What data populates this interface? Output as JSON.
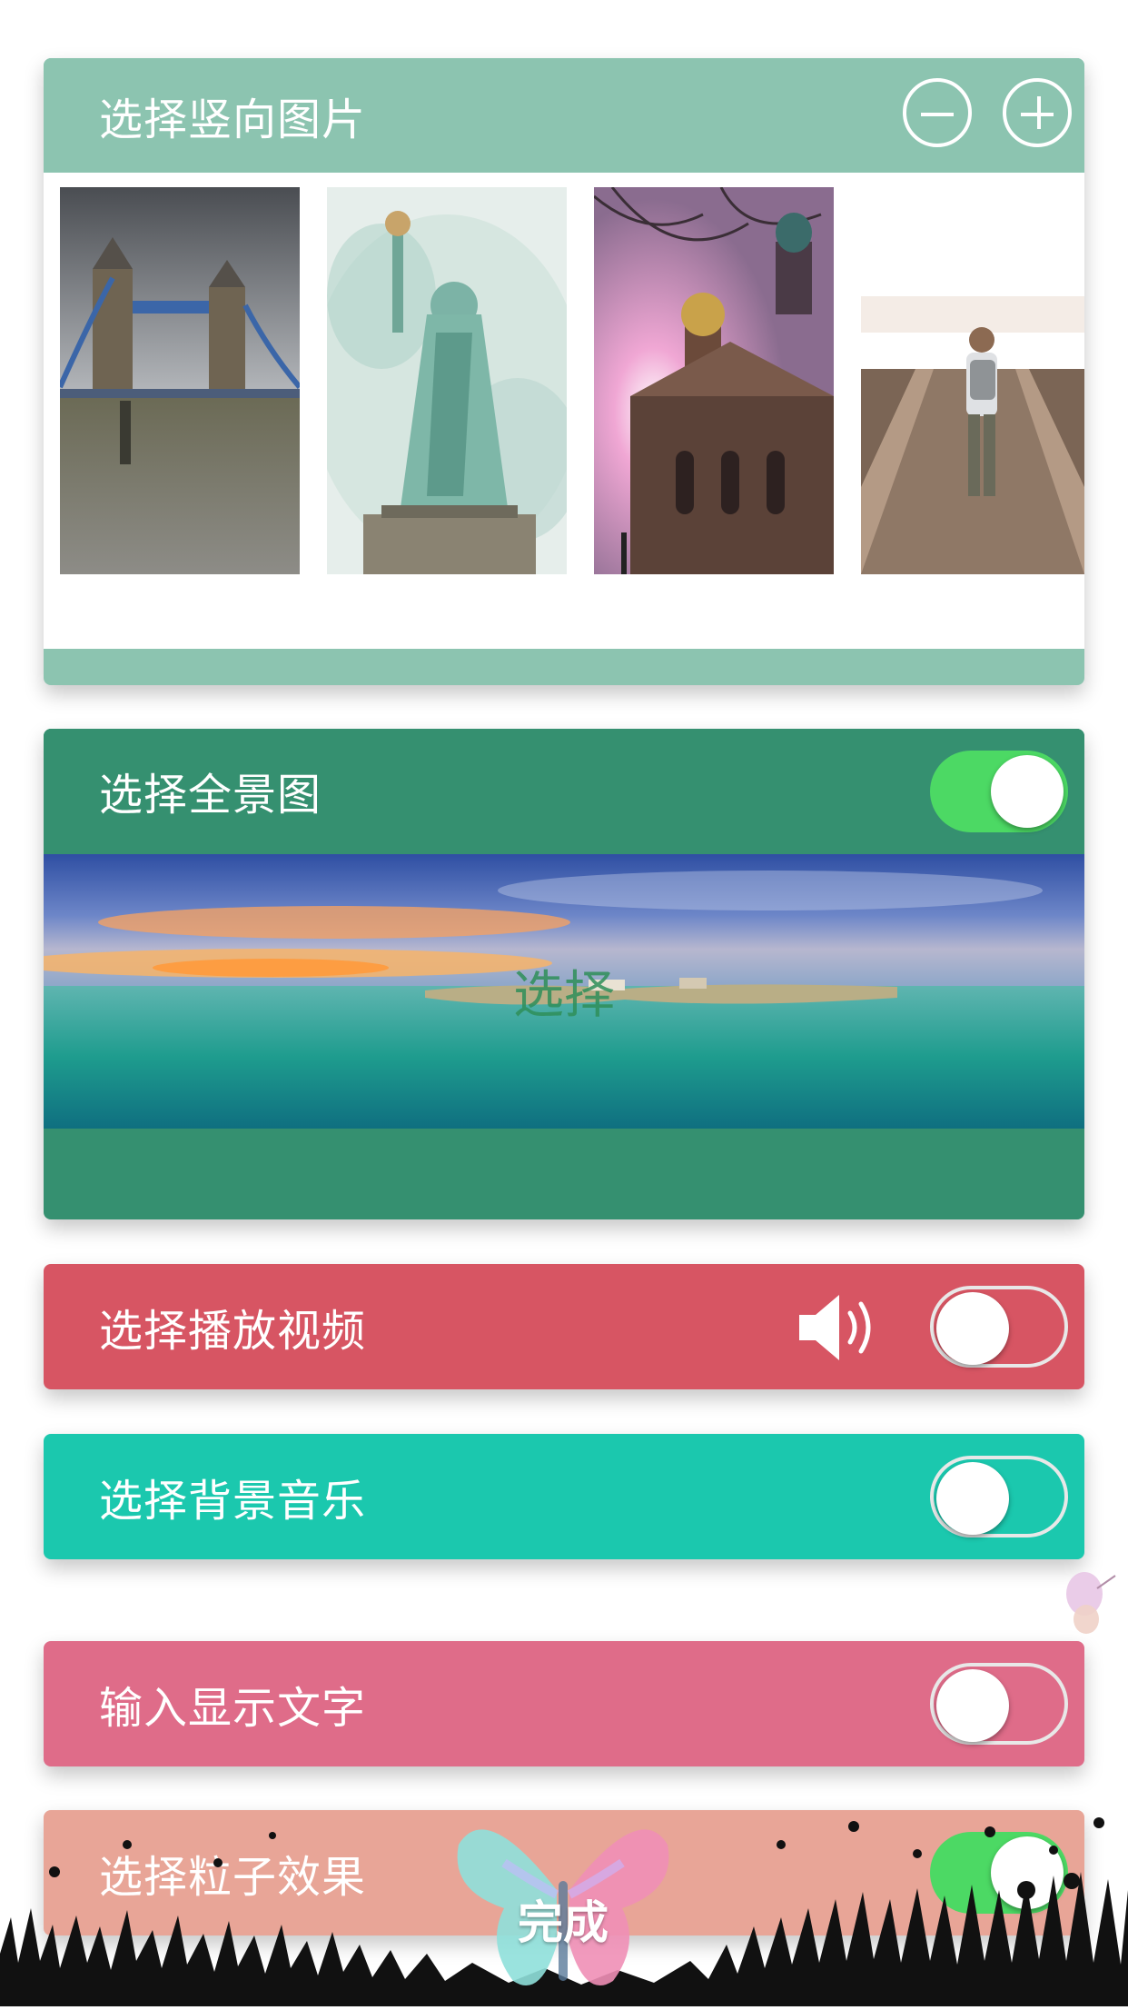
{
  "sections": {
    "vertical_images": {
      "title": "选择竖向图片"
    },
    "panorama": {
      "title": "选择全景图",
      "overlay_label": "选择",
      "toggle_on": true
    },
    "video": {
      "title": "选择播放视频",
      "toggle_on": false
    },
    "music": {
      "title": "选择背景音乐",
      "toggle_on": false
    },
    "text": {
      "title": "输入显示文字",
      "toggle_on": false
    },
    "particle": {
      "title": "选择粒子效果",
      "toggle_on": true
    }
  },
  "thumbnails": [
    {
      "name": "tower-bridge-photo"
    },
    {
      "name": "statue-of-liberty-photo"
    },
    {
      "name": "church-domes-photo"
    },
    {
      "name": "man-on-bridge-photo"
    }
  ],
  "footer": {
    "done_label": "完成"
  },
  "colors": {
    "card_vertical": "#8cc4b0",
    "card_panorama": "#359070",
    "card_video": "#d75563",
    "card_music": "#1bc8ae",
    "card_text": "#df6c89",
    "card_particle": "#e8a597",
    "toggle_on": "#4cd964"
  }
}
